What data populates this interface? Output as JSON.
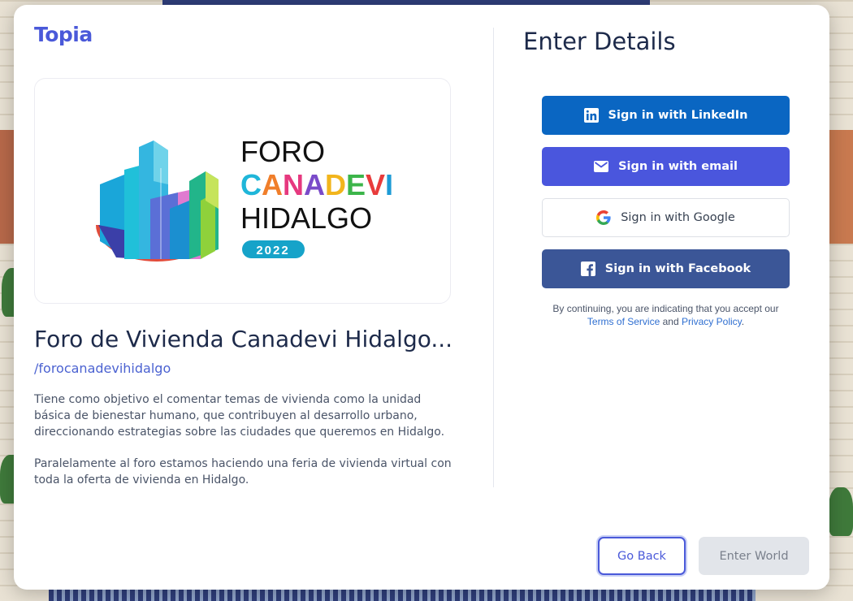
{
  "brand": {
    "logo_text": "Topia"
  },
  "space": {
    "banner": {
      "line1": "FORO",
      "line2": "CANADEVI",
      "line3": "HIDALGO",
      "year": "2022",
      "line2_letter_colors": [
        "#1fb6d9",
        "#f07e2a",
        "#e6397f",
        "#7a4bc9",
        "#f2b51c",
        "#3cb54a",
        "#e83b3b",
        "#1d9bd6"
      ]
    },
    "title": "Foro de Vivienda Canadevi Hidalgo...",
    "handle": "/forocanadevihidalgo",
    "description": [
      "Tiene como objetivo el comentar temas de vivienda como la unidad básica de bienestar humano, que contribuyen al desarrollo urbano, direccionando estrategias sobre las ciudades que queremos en Hidalgo.",
      "Paralelamente al foro estamos haciendo una feria de vivienda virtual con toda la oferta de vivienda en Hidalgo."
    ]
  },
  "details": {
    "title": "Enter Details",
    "buttons": {
      "linkedin": {
        "label": "Sign in with LinkedIn",
        "icon": "linkedin-icon",
        "color": "#0a66c2"
      },
      "email": {
        "label": "Sign in with email",
        "icon": "envelope-icon",
        "color": "#4a56dd"
      },
      "google": {
        "label": "Sign in with Google",
        "icon": "google-icon",
        "color": "#ffffff"
      },
      "facebook": {
        "label": "Sign in with Facebook",
        "icon": "facebook-icon",
        "color": "#3b5697"
      }
    },
    "terms": {
      "prefix": "By continuing, you are indicating that you accept our",
      "tos": "Terms of Service",
      "and": "and",
      "privacy": "Privacy Policy",
      "suffix": "."
    }
  },
  "footer": {
    "go_back": "Go Back",
    "enter_world": "Enter World"
  }
}
